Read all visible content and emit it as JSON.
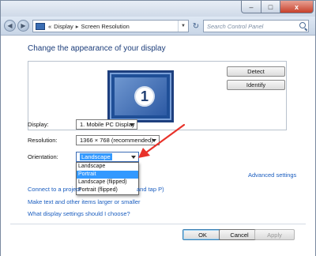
{
  "window": {
    "buttons": {
      "minimize": "–",
      "maximize": "□",
      "close": "x"
    }
  },
  "address_bar": {
    "nav_back": "◀",
    "nav_forward": "▶",
    "overflow": "«",
    "breadcrumb": [
      "Display",
      "Screen Resolution"
    ],
    "breadcrumb_sep": "▸",
    "dropdown_caret": "▼",
    "refresh": "↻",
    "search_placeholder": "Search Control Panel"
  },
  "main": {
    "heading": "Change the appearance of your display",
    "monitor_number": "1",
    "detect_label": "Detect",
    "identify_label": "Identify",
    "display_label": "Display:",
    "display_value": "1. Mobile PC Display",
    "resolution_label": "Resolution:",
    "resolution_value": "1366 × 768 (recommended)",
    "orientation_label": "Orientation:",
    "orientation_value": "Landscape",
    "orientation_options": [
      "Landscape",
      "Portrait",
      "Landscape (flipped)",
      "Portrait (flipped)"
    ],
    "highlighted_option": "Portrait",
    "advanced_settings": "Advanced settings",
    "link_connect_start": "Connect to a project",
    "link_connect_end": "and tap P)",
    "link_text_size": "Make text and other items larger or smaller",
    "link_what_settings": "What display settings should I choose?"
  },
  "footer": {
    "ok_label": "OK",
    "cancel_label": "Cancel",
    "apply_label": "Apply"
  },
  "colors": {
    "link": "#1a5dbf",
    "heading": "#1c3d7a",
    "selection": "#3399ff",
    "annotation_arrow": "#e8322a"
  }
}
